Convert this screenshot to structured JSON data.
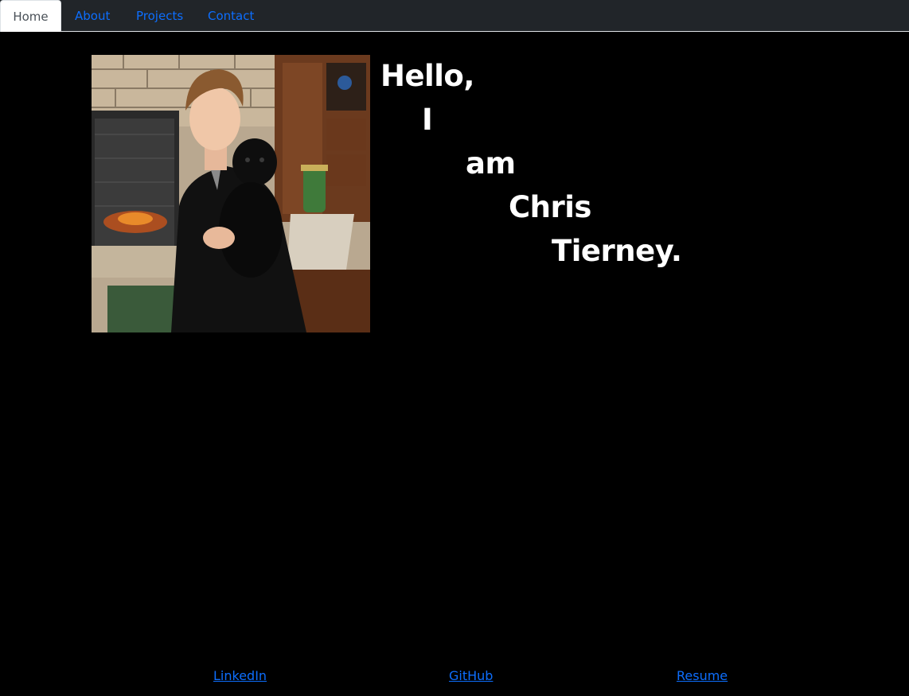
{
  "nav": {
    "tabs": [
      {
        "label": "Home",
        "active": true
      },
      {
        "label": "About",
        "active": false
      },
      {
        "label": "Projects",
        "active": false
      },
      {
        "label": "Contact",
        "active": false
      }
    ]
  },
  "hero": {
    "words": [
      "Hello,",
      "I",
      "am",
      "Chris",
      "Tierney."
    ]
  },
  "footer": {
    "links": [
      {
        "label": "LinkedIn"
      },
      {
        "label": "GitHub"
      },
      {
        "label": "Resume"
      }
    ]
  },
  "colors": {
    "background": "#000000",
    "navbar": "#212529",
    "link": "#0d6efd",
    "active_tab_bg": "#ffffff",
    "active_tab_text": "#495057",
    "heading": "#ffffff"
  }
}
